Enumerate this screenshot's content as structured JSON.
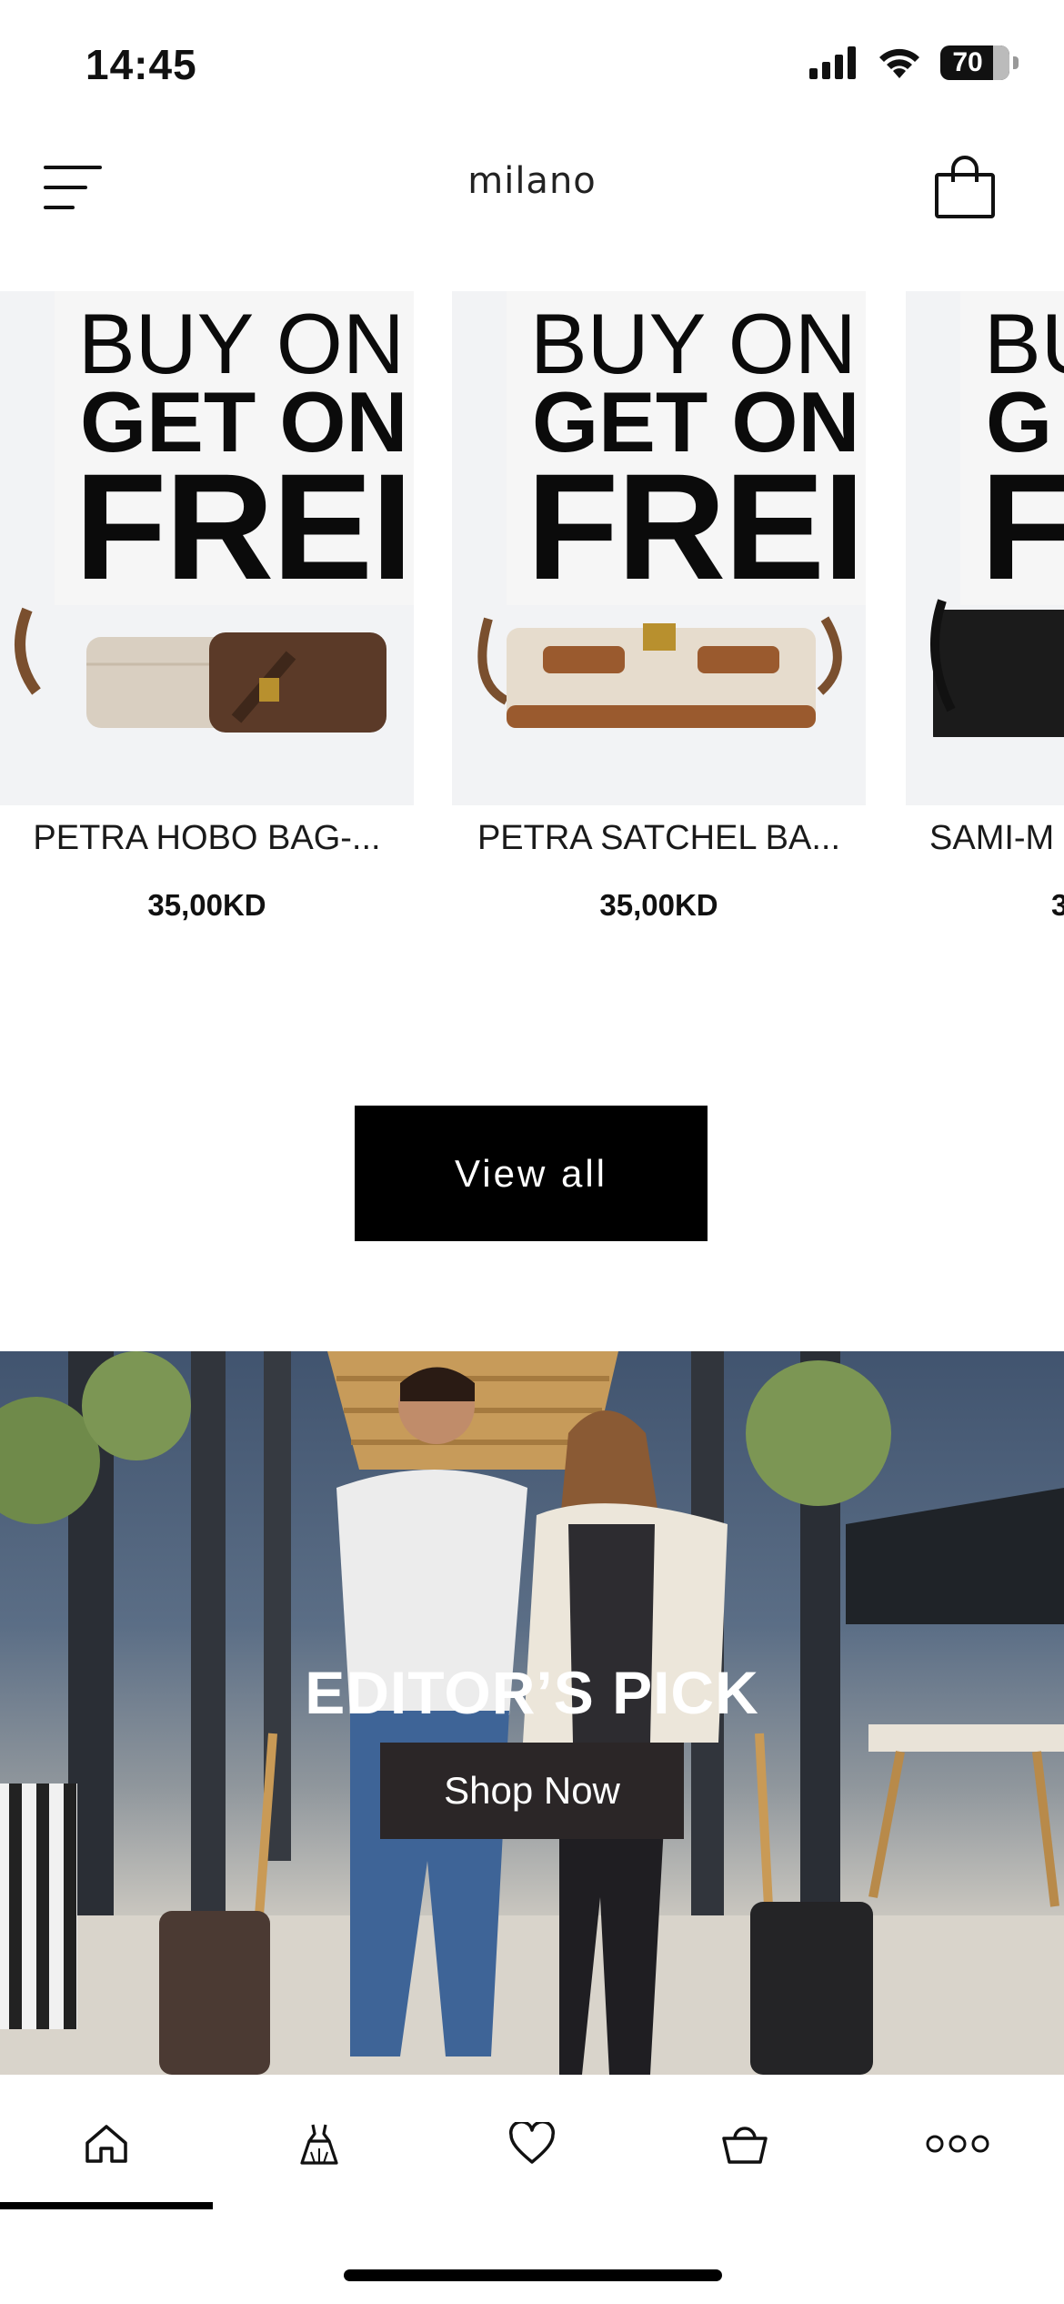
{
  "status_bar": {
    "time": "14:45",
    "battery": "70"
  },
  "header": {
    "logo_text": "milano",
    "menu_icon": "hamburger-menu-icon",
    "cart_icon": "shopping-bag-icon"
  },
  "products": [
    {
      "promo": {
        "line1": "BUY ON",
        "line2": "GET ON",
        "line3": "FREI"
      },
      "name": "PETRA HOBO BAG-...",
      "price": "35,00KD"
    },
    {
      "promo": {
        "line1": "BUY ON",
        "line2": "GET ON",
        "line3": "FREI"
      },
      "name": "PETRA SATCHEL BA...",
      "price": "35,00KD"
    },
    {
      "promo": {
        "line1": "BU",
        "line2": "G",
        "line3": "F"
      },
      "name": "SAMI-M",
      "price": "3"
    }
  ],
  "view_all_label": "View all",
  "editors_pick": {
    "title": "EDITOR’S PICK",
    "button_label": "Shop Now"
  },
  "bottom_nav": {
    "items": [
      {
        "icon": "home-icon",
        "active": true
      },
      {
        "icon": "dress-icon",
        "active": false
      },
      {
        "icon": "heart-icon",
        "active": false
      },
      {
        "icon": "basket-icon",
        "active": false
      },
      {
        "icon": "more-icon",
        "active": false
      }
    ]
  },
  "colors": {
    "primary": "#000000",
    "placeholder_bg": "#f2f3f5",
    "banner_button_bg": "#2b2627"
  }
}
